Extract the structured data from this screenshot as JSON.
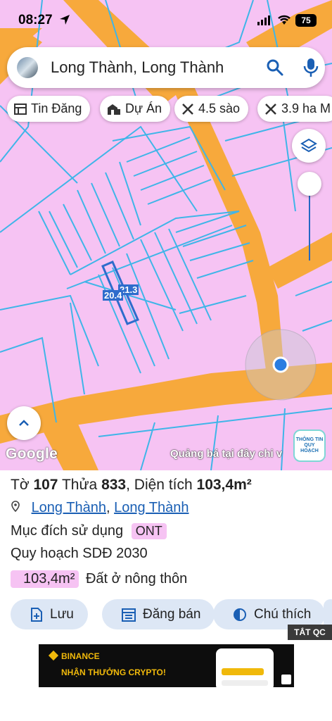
{
  "status": {
    "time": "08:27",
    "battery": "75"
  },
  "search": {
    "query": "Long Thành, Long Thành"
  },
  "chips": [
    {
      "label": "Tin Đăng",
      "icon": "newspaper-icon"
    },
    {
      "label": "Dự Án",
      "icon": "buildings-icon"
    },
    {
      "label": "4.5 sào",
      "icon": "measure-icon"
    },
    {
      "label": "3.9 ha M",
      "icon": "measure-icon"
    }
  ],
  "map": {
    "dim_a": "21.3",
    "dim_b": "20.4",
    "google": "Google",
    "ad_text": "Quảng bá tại đây chi v",
    "badge_line1": "THÔNG TIN",
    "badge_line2": "QUY HOẠCH",
    "land_color": "#f6c3f3",
    "road_color": "#f7a93c",
    "parcel_line_color": "#3fb5e8",
    "location_dot_color": "#2a7de1"
  },
  "parcel": {
    "to_label": "Tờ",
    "to_value": "107",
    "thua_label": "Thửa",
    "thua_value": "833",
    "dientich_label": "Diện tích",
    "dientich_value": "103,4m²",
    "location_a": "Long Thành",
    "location_b": "Long Thành",
    "purpose_label": "Mục đích sử dụng",
    "purpose_code": "ONT",
    "plan_label": "Quy hoạch SDĐ 2030",
    "area_badge": "103,4m²",
    "area_type": "Đất ở nông thôn"
  },
  "actions": [
    {
      "label": "Lưu",
      "icon": "add-file-icon"
    },
    {
      "label": "Đăng bán",
      "icon": "calendar-list-icon"
    },
    {
      "label": "Chú thích",
      "icon": "contrast-icon"
    }
  ],
  "ad": {
    "close_label": "TẮT QC",
    "brand": "BINANCE",
    "headline": "NHẬN THƯỞNG CRYPTO!"
  }
}
